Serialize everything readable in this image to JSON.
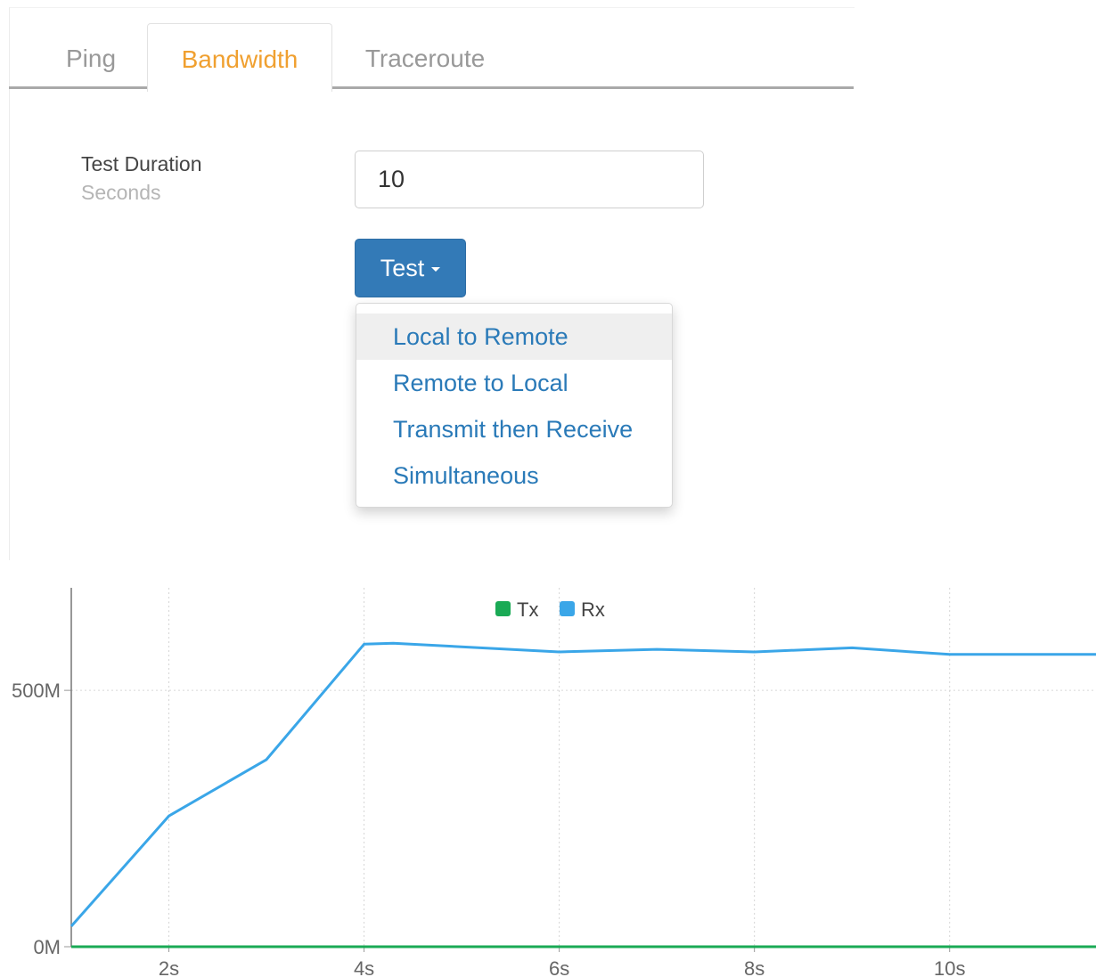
{
  "tabs": [
    {
      "label": "Ping",
      "active": false
    },
    {
      "label": "Bandwidth",
      "active": true
    },
    {
      "label": "Traceroute",
      "active": false
    }
  ],
  "form": {
    "duration_label": "Test Duration",
    "duration_help": "Seconds",
    "duration_value": "10"
  },
  "test_button": {
    "label": "Test",
    "icon": "caret-down-icon"
  },
  "dropdown": {
    "items": [
      "Local to Remote",
      "Remote to Local",
      "Transmit then Receive",
      "Simultaneous"
    ],
    "highlighted": "Local to Remote"
  },
  "colors": {
    "accent": "#f0a030",
    "primary": "#337ab7",
    "link": "#2a7ab8",
    "tx": "#1aaa55",
    "rx": "#3aa6e8"
  },
  "chart_data": {
    "type": "line",
    "x_unit": "s",
    "y_unit": "M",
    "xlim": [
      1,
      11.5
    ],
    "ylim": [
      0,
      700
    ],
    "x_ticks": [
      "2s",
      "4s",
      "6s",
      "8s",
      "10s"
    ],
    "x_tick_values": [
      2,
      4,
      6,
      8,
      10
    ],
    "y_ticks": [
      "0M",
      "500M"
    ],
    "y_tick_values": [
      0,
      500
    ],
    "grid": true,
    "legend": "top-center",
    "series": [
      {
        "name": "Tx",
        "color": "#1aaa55",
        "x": [
          1,
          2,
          3,
          4,
          5,
          6,
          7,
          8,
          9,
          10,
          11,
          11.5
        ],
        "y": [
          0,
          0,
          0,
          0,
          0,
          0,
          0,
          0,
          0,
          0,
          0,
          0
        ]
      },
      {
        "name": "Rx",
        "color": "#3aa6e8",
        "x": [
          1,
          2,
          3,
          4,
          4.3,
          6,
          7,
          8,
          9,
          10,
          11,
          11.5
        ],
        "y": [
          40,
          255,
          365,
          590,
          592,
          575,
          580,
          575,
          583,
          570,
          570,
          570
        ]
      }
    ]
  }
}
